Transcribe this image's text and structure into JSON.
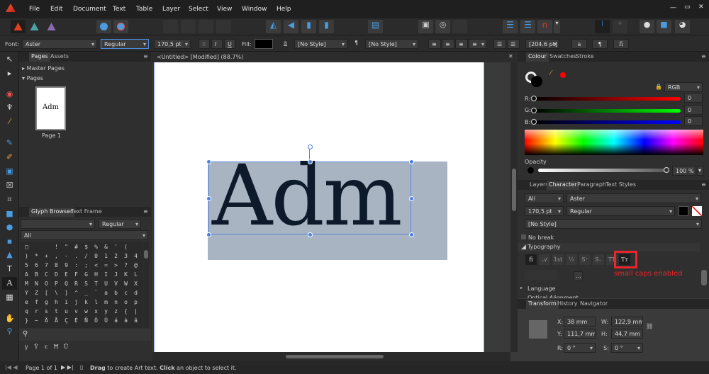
{
  "menu": [
    "File",
    "Edit",
    "Document",
    "Text",
    "Table",
    "Layer",
    "Select",
    "View",
    "Window",
    "Help"
  ],
  "context": {
    "font_label": "Font:",
    "font": "Aster",
    "style": "Regular",
    "size": "170,5 pt",
    "bold": "B",
    "italic": "I",
    "underline": "U",
    "fill_label": "Fill:",
    "char_style": "[No Style]",
    "para_style": "[No Style]",
    "leading": "[204.6 pt]",
    "btn_a": "a",
    "btn_para": "¶",
    "btn_fi": "fi"
  },
  "pages_panel": {
    "tabs": [
      "Pages",
      "Assets"
    ],
    "master_pages": "Master Pages",
    "pages": "Pages",
    "thumb_text": "Adm",
    "page_label": "Page 1"
  },
  "glyph_panel": {
    "tabs": [
      "Glyph Browser",
      "Text Frame"
    ],
    "font": "",
    "style": "Regular",
    "filter": "All",
    "rows": [
      "□  !\"#$%&'(",
      ")*+,-./01234",
      "56789:;<=>?@",
      "ABCDEFGHIJKL",
      "MNOPQRSTUVWX",
      "YZ[\\]^_`abcd",
      "efghijklmnop",
      "qrstuvwxyz{|",
      "}~ÄÅÇÉÑÖÜáàâ"
    ],
    "recent": [
      "γ",
      "Ŷ",
      "ε",
      "Ħ",
      "Ū"
    ]
  },
  "document": {
    "title": "<Untitled> [Modified] (88.7%)",
    "text": "Adm"
  },
  "colour_panel": {
    "tabs": [
      "Colour",
      "Swatches",
      "Stroke"
    ],
    "model": "RGB",
    "r_label": "R:",
    "g_label": "G:",
    "b_label": "B:",
    "r": "0",
    "g": "0",
    "b": "0",
    "opacity_label": "Opacity",
    "opacity": "100 %",
    "opacity_fraction": 1.0
  },
  "character_panel": {
    "tabs": [
      "Layers",
      "Character",
      "Paragraph",
      "Text Styles"
    ],
    "scope": "All",
    "font": "Aster",
    "size": "170,5 pt",
    "style": "Regular",
    "char_style": "[No Style]",
    "no_break": "No break",
    "typography": "Typography",
    "typo_buttons": [
      "fi",
      "𝒜",
      "1st",
      "½",
      "S⁺",
      "S₋",
      "TT",
      "Tт"
    ],
    "more": "...",
    "annotation": "small caps enabled",
    "language": "Language",
    "optical": "Optical Alignment"
  },
  "transform_panel": {
    "tabs": [
      "Transform",
      "History",
      "Navigator"
    ],
    "x_label": "X:",
    "x": "38 mm",
    "y_label": "Y:",
    "y": "111,7 mm",
    "w_label": "W:",
    "w": "122,9 mm",
    "h_label": "H:",
    "h": "44,7 mm",
    "r_label": "R:",
    "r": "0 °",
    "s_label": "S:",
    "s": "0 °"
  },
  "status": {
    "page": "Page 1 of 1",
    "hint_bold1": "Drag",
    "hint1": " to create Art text. ",
    "hint_bold2": "Click",
    "hint2": " an object to select it."
  },
  "colors": {
    "accent": "#3a8ee6",
    "annotation": "#e8262b",
    "frame_fill": "#a9b4c2",
    "text": "#0d1a2b"
  }
}
